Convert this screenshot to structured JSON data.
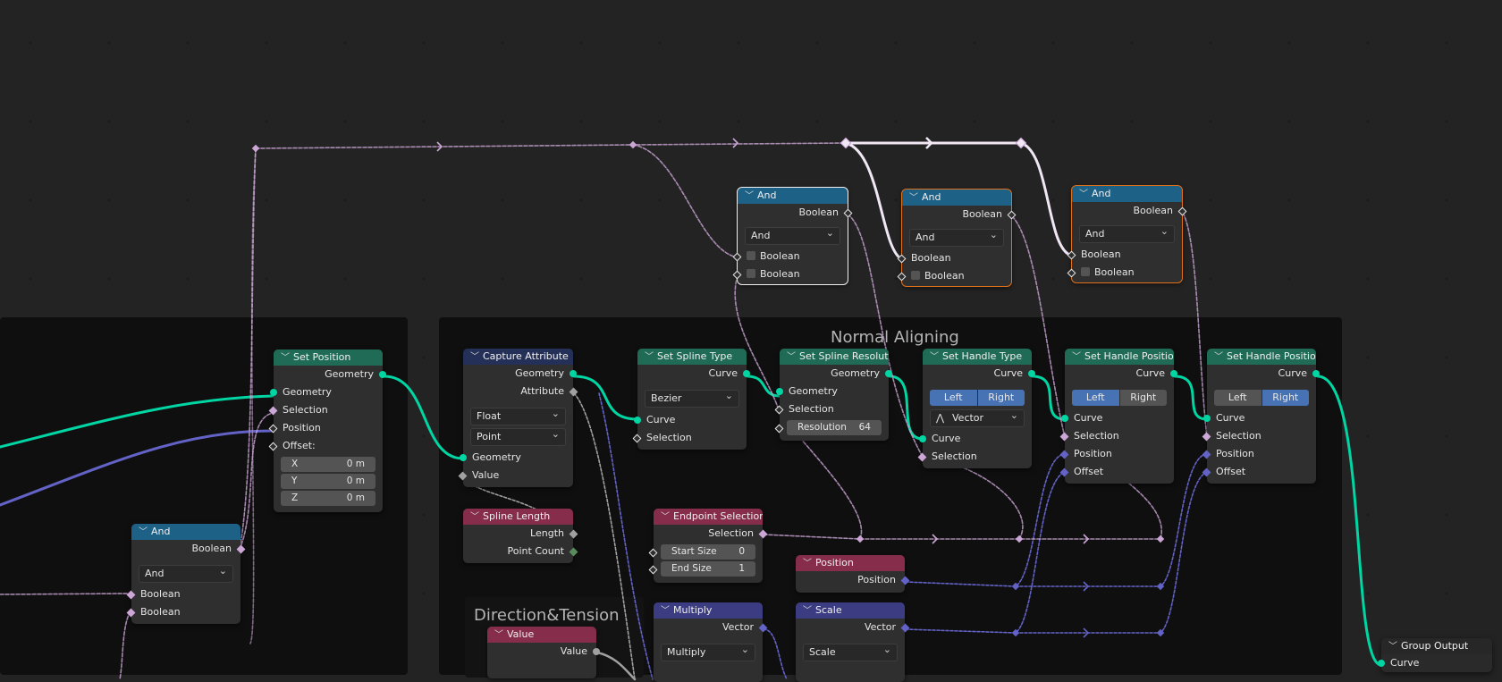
{
  "editor": "Geometry Node Editor",
  "frames": {
    "normal_aligning": "Normal Aligning",
    "direction_tension": "Direction&Tension"
  },
  "colors": {
    "geometry_socket": "#00d6a3",
    "boolean_socket": "#cca6d6",
    "vector_socket": "#6363c7",
    "float_socket": "#a1a1a1",
    "integer_socket": "#598c5c",
    "geometry_header": "#1f6b55",
    "function_header": "#1e6186",
    "input_header": "#852d4b",
    "vector_header": "#3c3c83",
    "selection_outline_active": "#f2f2f2",
    "selection_outline": "#e0701a"
  },
  "nodes": {
    "set_position": {
      "title": "Set Position",
      "output": "Geometry",
      "inputs": [
        "Geometry",
        "Selection",
        "Position",
        "Offset:"
      ],
      "offset": [
        {
          "axis": "X",
          "value": "0 m"
        },
        {
          "axis": "Y",
          "value": "0 m"
        },
        {
          "axis": "Z",
          "value": "0 m"
        }
      ]
    },
    "and_left": {
      "title": "And",
      "output": "Boolean",
      "operation": "And",
      "inputs": [
        "Boolean",
        "Boolean"
      ]
    },
    "and_top_1": {
      "title": "And",
      "output": "Boolean",
      "operation": "And",
      "inputs": [
        "Boolean",
        "Boolean"
      ]
    },
    "and_top_2": {
      "title": "And",
      "output": "Boolean",
      "operation": "And",
      "inputs": [
        "Boolean",
        "Boolean"
      ]
    },
    "and_top_3": {
      "title": "And",
      "output": "Boolean",
      "operation": "And",
      "inputs": [
        "Boolean",
        "Boolean"
      ]
    },
    "capture_attribute": {
      "title": "Capture Attribute",
      "outputs": [
        "Geometry",
        "Attribute"
      ],
      "data_type": "Float",
      "domain": "Point",
      "inputs": [
        "Geometry",
        "Value"
      ]
    },
    "set_spline_type": {
      "title": "Set Spline Type",
      "output": "Curve",
      "spline_type": "Bezier",
      "inputs": [
        "Curve",
        "Selection"
      ]
    },
    "set_spline_resolution": {
      "title": "Set Spline Resolution",
      "output": "Geometry",
      "inputs": [
        "Geometry",
        "Selection"
      ],
      "resolution_label": "Resolution",
      "resolution_value": "64"
    },
    "set_handle_type": {
      "title": "Set Handle Type",
      "output": "Curve",
      "mode": [
        {
          "label": "Left",
          "active": true
        },
        {
          "label": "Right",
          "active": true
        }
      ],
      "handle_type": "Vector",
      "inputs": [
        "Curve",
        "Selection"
      ]
    },
    "set_handle_positions_1": {
      "title": "Set Handle Positions",
      "output": "Curve",
      "mode": [
        {
          "label": "Left",
          "active": true
        },
        {
          "label": "Right",
          "active": false
        }
      ],
      "inputs": [
        "Curve",
        "Selection",
        "Position",
        "Offset"
      ]
    },
    "set_handle_positions_2": {
      "title": "Set Handle Positions",
      "output": "Curve",
      "mode": [
        {
          "label": "Left",
          "active": false
        },
        {
          "label": "Right",
          "active": true
        }
      ],
      "inputs": [
        "Curve",
        "Selection",
        "Position",
        "Offset"
      ]
    },
    "spline_length": {
      "title": "Spline Length",
      "outputs": [
        "Length",
        "Point Count"
      ]
    },
    "endpoint_selection": {
      "title": "Endpoint Selection",
      "output": "Selection",
      "fields": [
        {
          "label": "Start Size",
          "value": "0"
        },
        {
          "label": "End Size",
          "value": "1"
        }
      ]
    },
    "position": {
      "title": "Position",
      "output": "Position"
    },
    "multiply": {
      "title": "Multiply",
      "output": "Vector",
      "operation": "Multiply"
    },
    "scale": {
      "title": "Scale",
      "output": "Vector",
      "operation": "Scale"
    },
    "value": {
      "title": "Value",
      "output": "Value"
    },
    "group_output": {
      "title": "Group Output",
      "inputs": [
        "Curve"
      ]
    }
  }
}
